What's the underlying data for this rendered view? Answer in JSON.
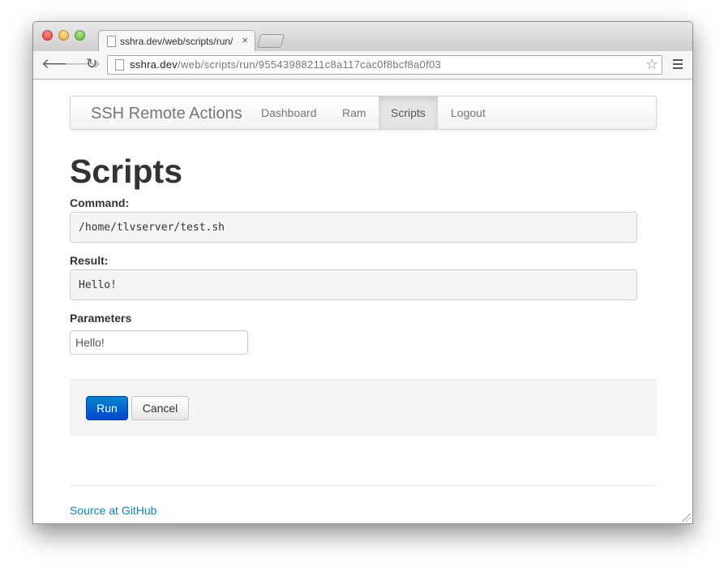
{
  "browser": {
    "tab_title": "sshra.dev/web/scripts/run/",
    "tab_close": "×",
    "url_host": "sshra.dev",
    "url_path": "/web/scripts/run/95543988211c8a117cac0f8bcf8a0f03",
    "back_icon": "🡐",
    "forward_icon": "🡒",
    "reload_icon": "↻",
    "star_icon": "☆"
  },
  "navbar": {
    "brand": "SSH Remote Actions",
    "links": [
      {
        "label": "Dashboard",
        "active": false
      },
      {
        "label": "Ram",
        "active": false
      },
      {
        "label": "Scripts",
        "active": true
      },
      {
        "label": "Logout",
        "active": false
      }
    ]
  },
  "page": {
    "title": "Scripts",
    "command_label": "Command:",
    "command_value": "/home/tlvserver/test.sh",
    "result_label": "Result:",
    "result_value": "Hello!",
    "parameters_label": "Parameters",
    "parameters_value": "Hello!"
  },
  "actions": {
    "run_label": "Run",
    "cancel_label": "Cancel"
  },
  "footer": {
    "link_label": "Source at GitHub"
  },
  "colors": {
    "primary": "#0088cc",
    "link": "#0088cc"
  }
}
